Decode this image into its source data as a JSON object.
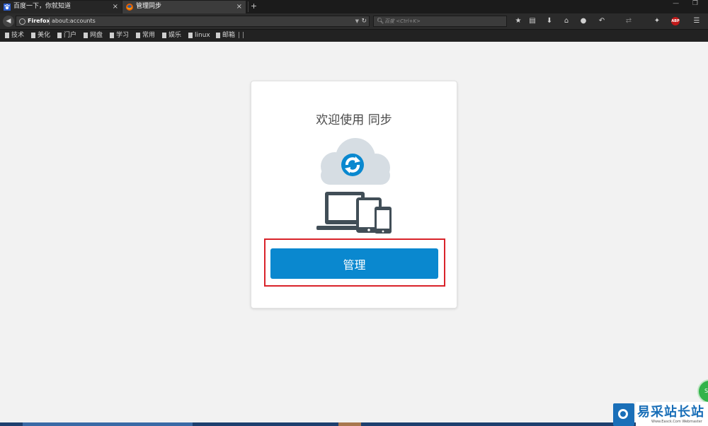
{
  "tabs": [
    {
      "title": "百度一下，你就知道",
      "favicon": "baidu-paw-icon",
      "active": false
    },
    {
      "title": "管理同步",
      "favicon": "firefox-icon",
      "active": true
    }
  ],
  "tab_close_glyph": "×",
  "new_tab_glyph": "+",
  "window_controls": "— ❐",
  "urlbar": {
    "identity": "Firefox",
    "url": "about:accounts"
  },
  "search": {
    "placeholder": "百度 <Ctrl+K>"
  },
  "toolbar_icons": [
    "bookmark-star-icon",
    "reading-list-icon",
    "download-icon",
    "home-icon",
    "chat-icon",
    "undo-icon",
    "sync-icon",
    "bird-icon",
    "adblock-plus-icon",
    "menu-icon"
  ],
  "adblock_label": "ABP",
  "bookmarks": [
    "技术",
    "美化",
    "门户",
    "网盘",
    "学习",
    "常用",
    "娱乐",
    "linux",
    "邮箱"
  ],
  "bookmarks_overflow": "| |",
  "page": {
    "title": "欢迎使用 同步",
    "manage_button": "管理"
  },
  "colors": {
    "accent": "#0a88cf",
    "highlight_border": "#d9232a",
    "illustration_dark": "#414e57",
    "illustration_cloud": "#d6dde3"
  },
  "overlay": {
    "save_badge": "Sa",
    "watermark_cn": "易采站长站",
    "watermark_en": "Www.Easck.Com Webmaster"
  }
}
